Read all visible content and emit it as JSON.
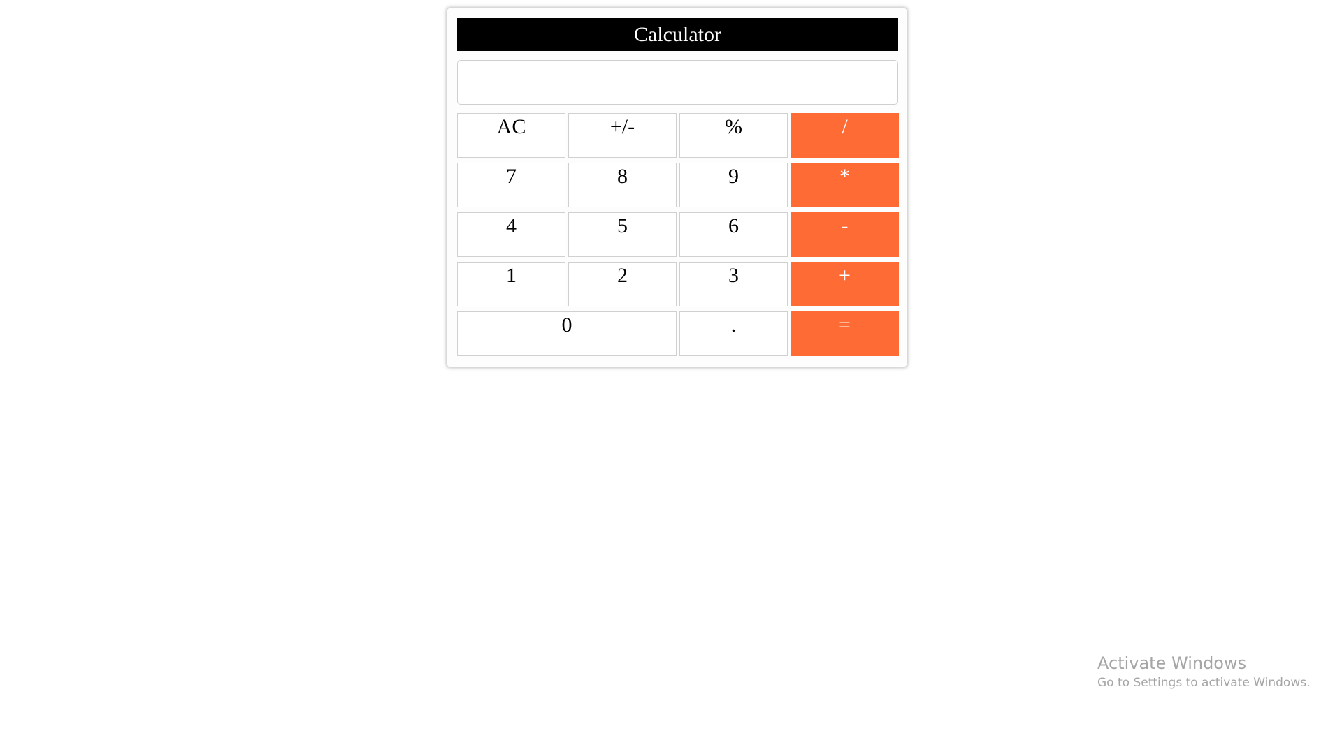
{
  "calculator": {
    "title": "Calculator",
    "display_value": "",
    "colors": {
      "title_bg": "#000000",
      "title_fg": "#ffffff",
      "operator_bg": "#ff6b35",
      "operator_fg": "#ffffff",
      "key_bg": "#ffffff"
    },
    "keys": {
      "ac": "AC",
      "sign": "+/-",
      "percent": "%",
      "divide": "/",
      "seven": "7",
      "eight": "8",
      "nine": "9",
      "multiply": "*",
      "four": "4",
      "five": "5",
      "six": "6",
      "subtract": "-",
      "one": "1",
      "two": "2",
      "three": "3",
      "add": "+",
      "zero": "0",
      "decimal": ".",
      "equals": "="
    }
  },
  "watermark": {
    "title": "Activate Windows",
    "subtitle": "Go to Settings to activate Windows."
  }
}
